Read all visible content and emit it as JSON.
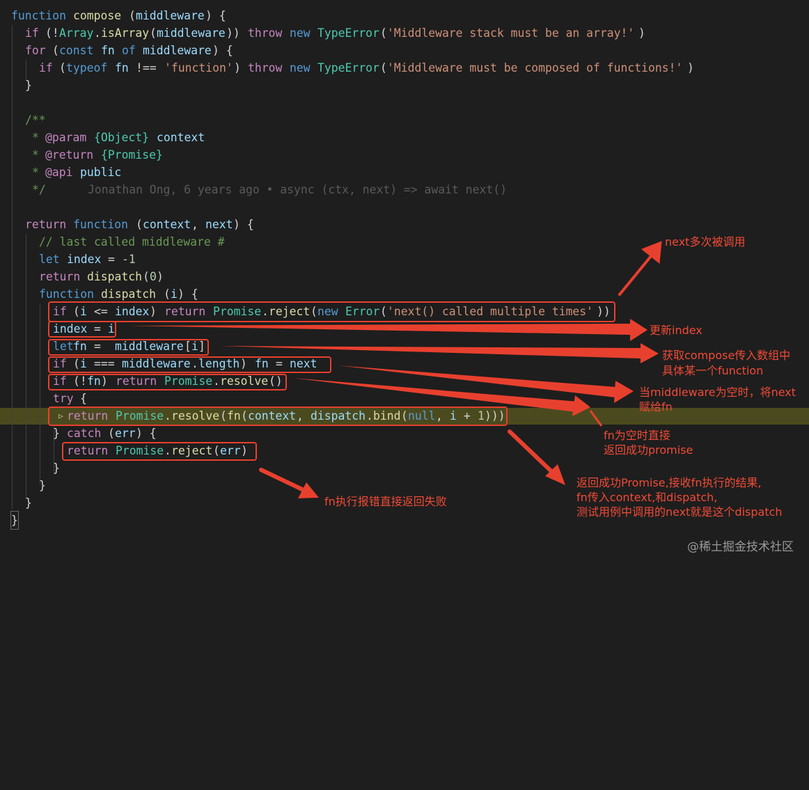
{
  "code": {
    "l1": [
      "function",
      "compose",
      "(",
      "middleware",
      ") {"
    ],
    "l2": [
      "if",
      "(!",
      "Array",
      ".",
      "isArray",
      "(",
      "middleware",
      "))",
      "throw",
      "new",
      "TypeError",
      "(",
      "'Middleware stack must be an array!'",
      ")"
    ],
    "l3": [
      "for",
      "(",
      "const",
      "fn",
      "of",
      "middleware",
      ") {"
    ],
    "l4": [
      "if",
      "(",
      "typeof",
      "fn",
      "!==",
      "'function'",
      ")",
      "throw",
      "new",
      "TypeError",
      "(",
      "'Middleware must be composed of functions!'",
      ")"
    ],
    "l5": "}",
    "l7": "/**",
    "l8": [
      "*",
      "@param",
      "{Object}",
      "context"
    ],
    "l9": [
      "*",
      "@return",
      "{Promise}"
    ],
    "l10": [
      "*",
      "@api",
      "public"
    ],
    "l11": "*/",
    "blame": "Jonathan Ong, 6 years ago • async (ctx, next) => await next()",
    "l13": [
      "return",
      "function",
      "(",
      "context",
      ", ",
      "next",
      ") {"
    ],
    "l14": "// last called middleware #",
    "l15": [
      "let",
      "index",
      "=",
      "-1"
    ],
    "l16": [
      "return",
      "dispatch",
      "(",
      "0",
      ")"
    ],
    "l17": [
      "function",
      "dispatch",
      "(",
      "i",
      ") {"
    ],
    "l18": [
      "if",
      "(",
      "i",
      "<=",
      "index",
      ")",
      "return",
      "Promise",
      ".",
      "reject",
      "(",
      "new",
      "Error",
      "(",
      "'next() called multiple times'",
      "))"
    ],
    "l19": [
      "index",
      "=",
      "i"
    ],
    "l20": [
      "let",
      "fn",
      "=",
      "middleware",
      "[",
      "i",
      "]"
    ],
    "l21": [
      "if",
      "(",
      "i",
      "===",
      "middleware",
      ".",
      "length",
      ")",
      "fn",
      "=",
      "next"
    ],
    "l22": [
      "if",
      "(!",
      "fn",
      ")",
      "return",
      "Promise",
      ".",
      "resolve",
      "()"
    ],
    "l23": [
      "try",
      "{"
    ],
    "l24": [
      "▷",
      "return",
      "Promise",
      ".",
      "resolve",
      "(",
      "fn",
      "(",
      "context",
      ", ",
      "dispatch",
      ".",
      "bind",
      "(",
      "null",
      ", ",
      "i",
      " + ",
      "1",
      ")))"
    ],
    "l25": [
      "}",
      "catch",
      "(",
      "err",
      ") {"
    ],
    "l26": [
      "return",
      "Promise",
      ".",
      "reject",
      "(",
      "err",
      ")"
    ],
    "l27": "}",
    "l28": "}",
    "l29": "}",
    "l30": "}"
  },
  "annotations": {
    "next_multiple": "next多次被调用",
    "update_index": "更新index",
    "get_fn_1": "获取compose传入数组中",
    "get_fn_2": "具体某一个function",
    "empty_mw_1": "当middleware为空时，将next",
    "empty_mw_2": "赋给fn",
    "fn_empty_1": "fn为空时直接",
    "fn_empty_2": "返回成功promise",
    "return_success_1": "返回成功Promise,接收fn执行的结果,",
    "return_success_2": "fn传入context,和dispatch,",
    "return_success_3": "测试用例中调用的next就是这个dispatch",
    "fn_error": "fn执行报错直接返回失败"
  },
  "watermark": "@稀土掘金技术社区",
  "colors": {
    "background": "#1e1e1e",
    "highlight_line": "#4b4a1e",
    "annotation_red": "#f04b36"
  }
}
